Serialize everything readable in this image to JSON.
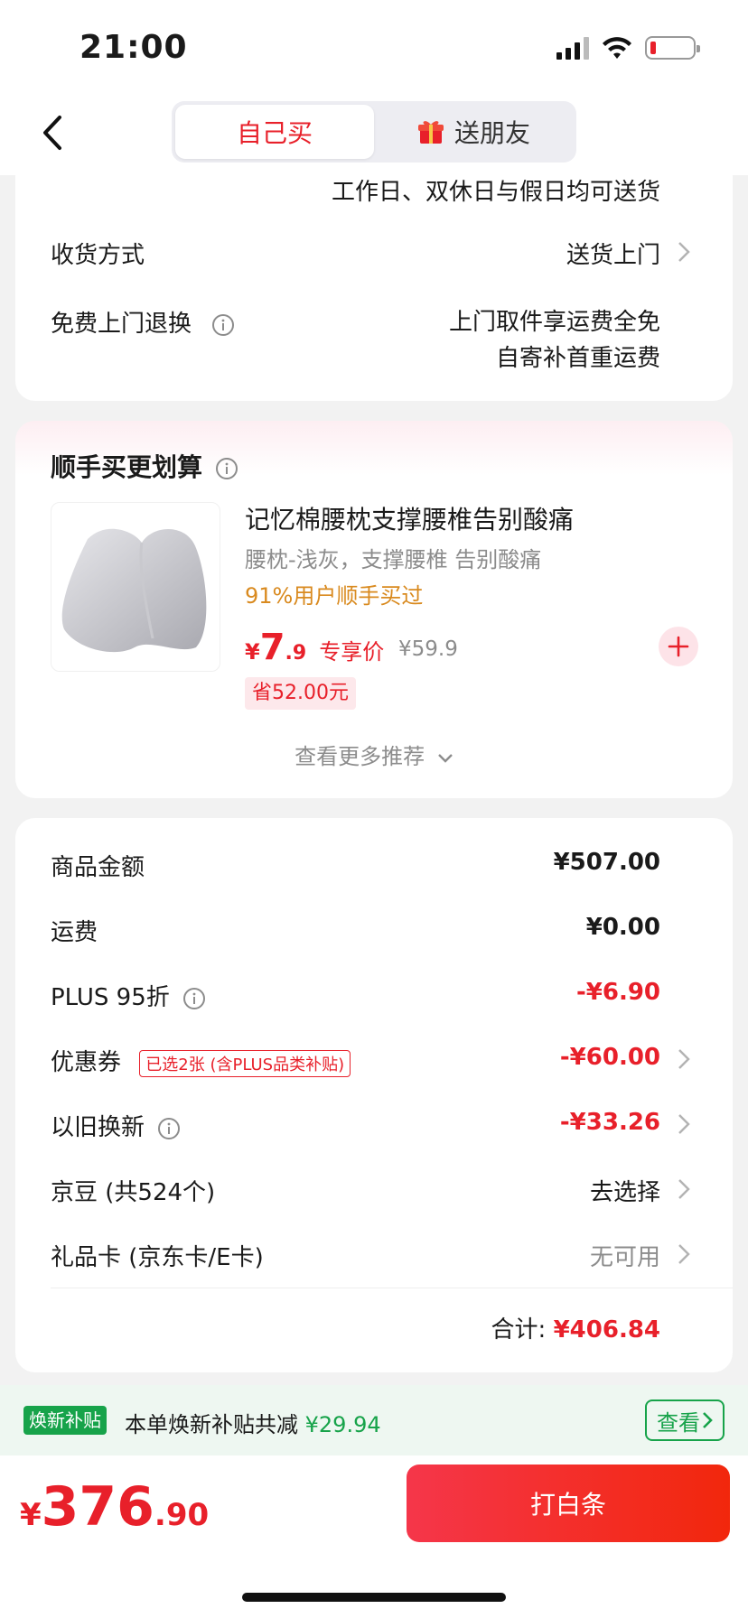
{
  "status": {
    "time": "21:00"
  },
  "nav": {
    "tabs": [
      "自己买",
      "送朋友"
    ]
  },
  "delivery": {
    "cut_text": "工作日、双休日与假日均可送货",
    "method_label": "收货方式",
    "method_value": "送货上门",
    "return_label": "免费上门退换",
    "return_value_1": "上门取件享运费全免",
    "return_value_2": "自寄补首重运费"
  },
  "addon": {
    "title": "顺手买更划算",
    "product_name": "记忆棉腰枕支撑腰椎告别酸痛",
    "product_spec": "腰枕-浅灰，支撑腰椎 告别酸痛",
    "buy_rate": "91%用户顺手买过",
    "price_symbol": "¥",
    "price_int": "7",
    "price_dec": ".9",
    "price_tag": "专享价",
    "original_price": "¥59.9",
    "save_text": "省52.00元",
    "more": "查看更多推荐"
  },
  "summary": {
    "goods_label": "商品金额",
    "goods_value": "¥507.00",
    "freight_label": "运费",
    "freight_value": "¥0.00",
    "plus_label": "PLUS 95折",
    "plus_value": "-¥6.90",
    "coupon_label": "优惠券",
    "coupon_tag": "已选2张 (含PLUS品类补贴)",
    "coupon_value": "-¥60.00",
    "tradein_label": "以旧换新",
    "tradein_value": "-¥33.26",
    "beans_label": "京豆 (共524个)",
    "beans_value": "去选择",
    "giftcard_label": "礼品卡 (京东卡/E卡)",
    "giftcard_value": "无可用",
    "total_label": "合计:",
    "total_value": "¥406.84"
  },
  "subsidy": {
    "badge": "焕新补贴",
    "text": "本单焕新补贴共减",
    "amount": "¥29.94",
    "view": "查看"
  },
  "footer": {
    "price_symbol": "¥",
    "price_int": "376",
    "price_dec": ".90",
    "pay_button": "打白条"
  },
  "colors": {
    "accent": "#e8202a",
    "green": "#17a34a"
  }
}
